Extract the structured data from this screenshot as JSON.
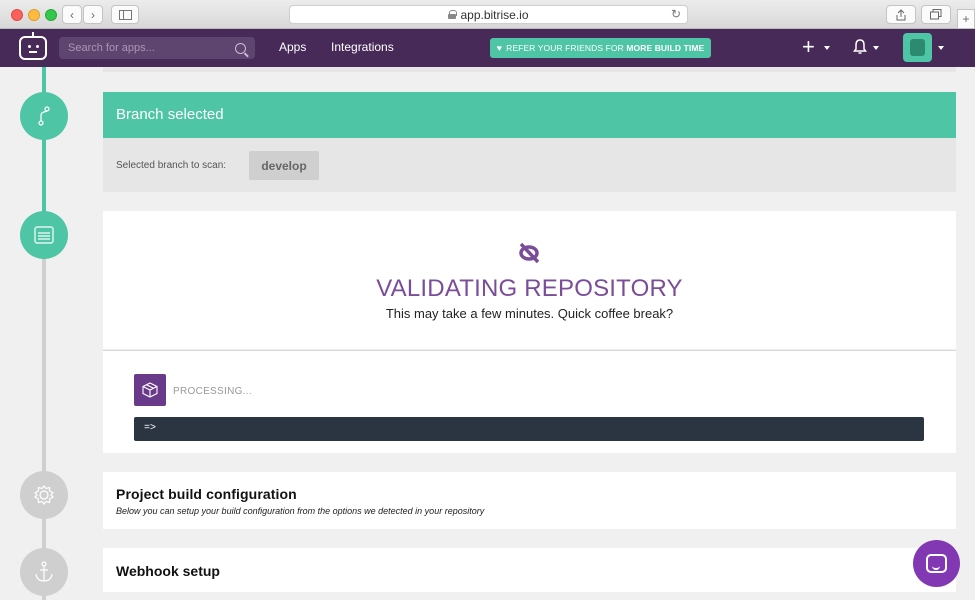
{
  "browser": {
    "url": "app.bitrise.io"
  },
  "nav": {
    "search_placeholder": "Search for apps...",
    "links": [
      "Apps",
      "Integrations"
    ],
    "refer_prefix": "REFER YOUR FRIENDS FOR ",
    "refer_emph": "MORE BUILD TIME",
    "plus_label": "+"
  },
  "branch": {
    "title": "Branch selected",
    "label": "Selected branch to scan:",
    "value": "develop"
  },
  "validation": {
    "title": "VALIDATING REPOSITORY",
    "subtitle": "This may take a few minutes. Quick coffee break?",
    "status": "PROCESSING...",
    "console": "=>"
  },
  "steps": {
    "build_config": {
      "title": "Project build configuration",
      "subtitle": "Below you can setup your build configuration from the options we detected in your repository"
    },
    "webhook": {
      "title": "Webhook setup"
    }
  },
  "colors": {
    "brand_purple": "#472a57",
    "accent_green": "#4ec5a4",
    "title_purple": "#7b4d99",
    "console_bg": "#2b3542",
    "chat_purple": "#8338b3"
  }
}
